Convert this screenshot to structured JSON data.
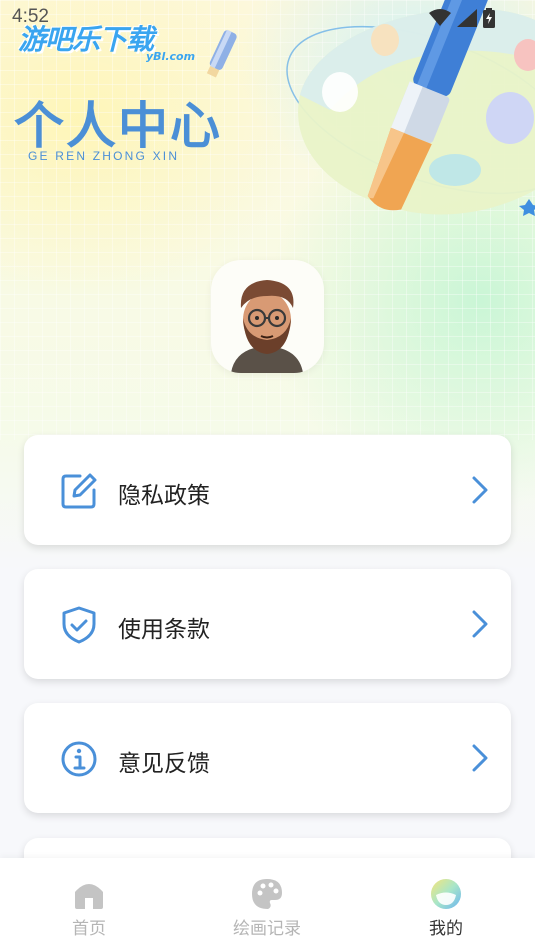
{
  "status_bar": {
    "time": "4:52"
  },
  "watermark": {
    "brand": "游吧乐下载",
    "domain": "yBl.com"
  },
  "header": {
    "title": "个人中心",
    "subtitle": "GE REN ZHONG XIN"
  },
  "menu": {
    "items": [
      {
        "label": "隐私政策",
        "icon": "edit-icon"
      },
      {
        "label": "使用条款",
        "icon": "shield-check-icon"
      },
      {
        "label": "意见反馈",
        "icon": "info-icon"
      }
    ]
  },
  "bottom_nav": {
    "items": [
      {
        "label": "首页",
        "icon": "home-icon",
        "active": false
      },
      {
        "label": "绘画记录",
        "icon": "palette-icon",
        "active": false
      },
      {
        "label": "我的",
        "icon": "profile-icon",
        "active": true
      }
    ]
  },
  "colors": {
    "accent": "#4b8fd6",
    "icon_blue": "#4a90d9",
    "inactive_nav": "#b5b5b5",
    "active_nav": "#333333"
  }
}
